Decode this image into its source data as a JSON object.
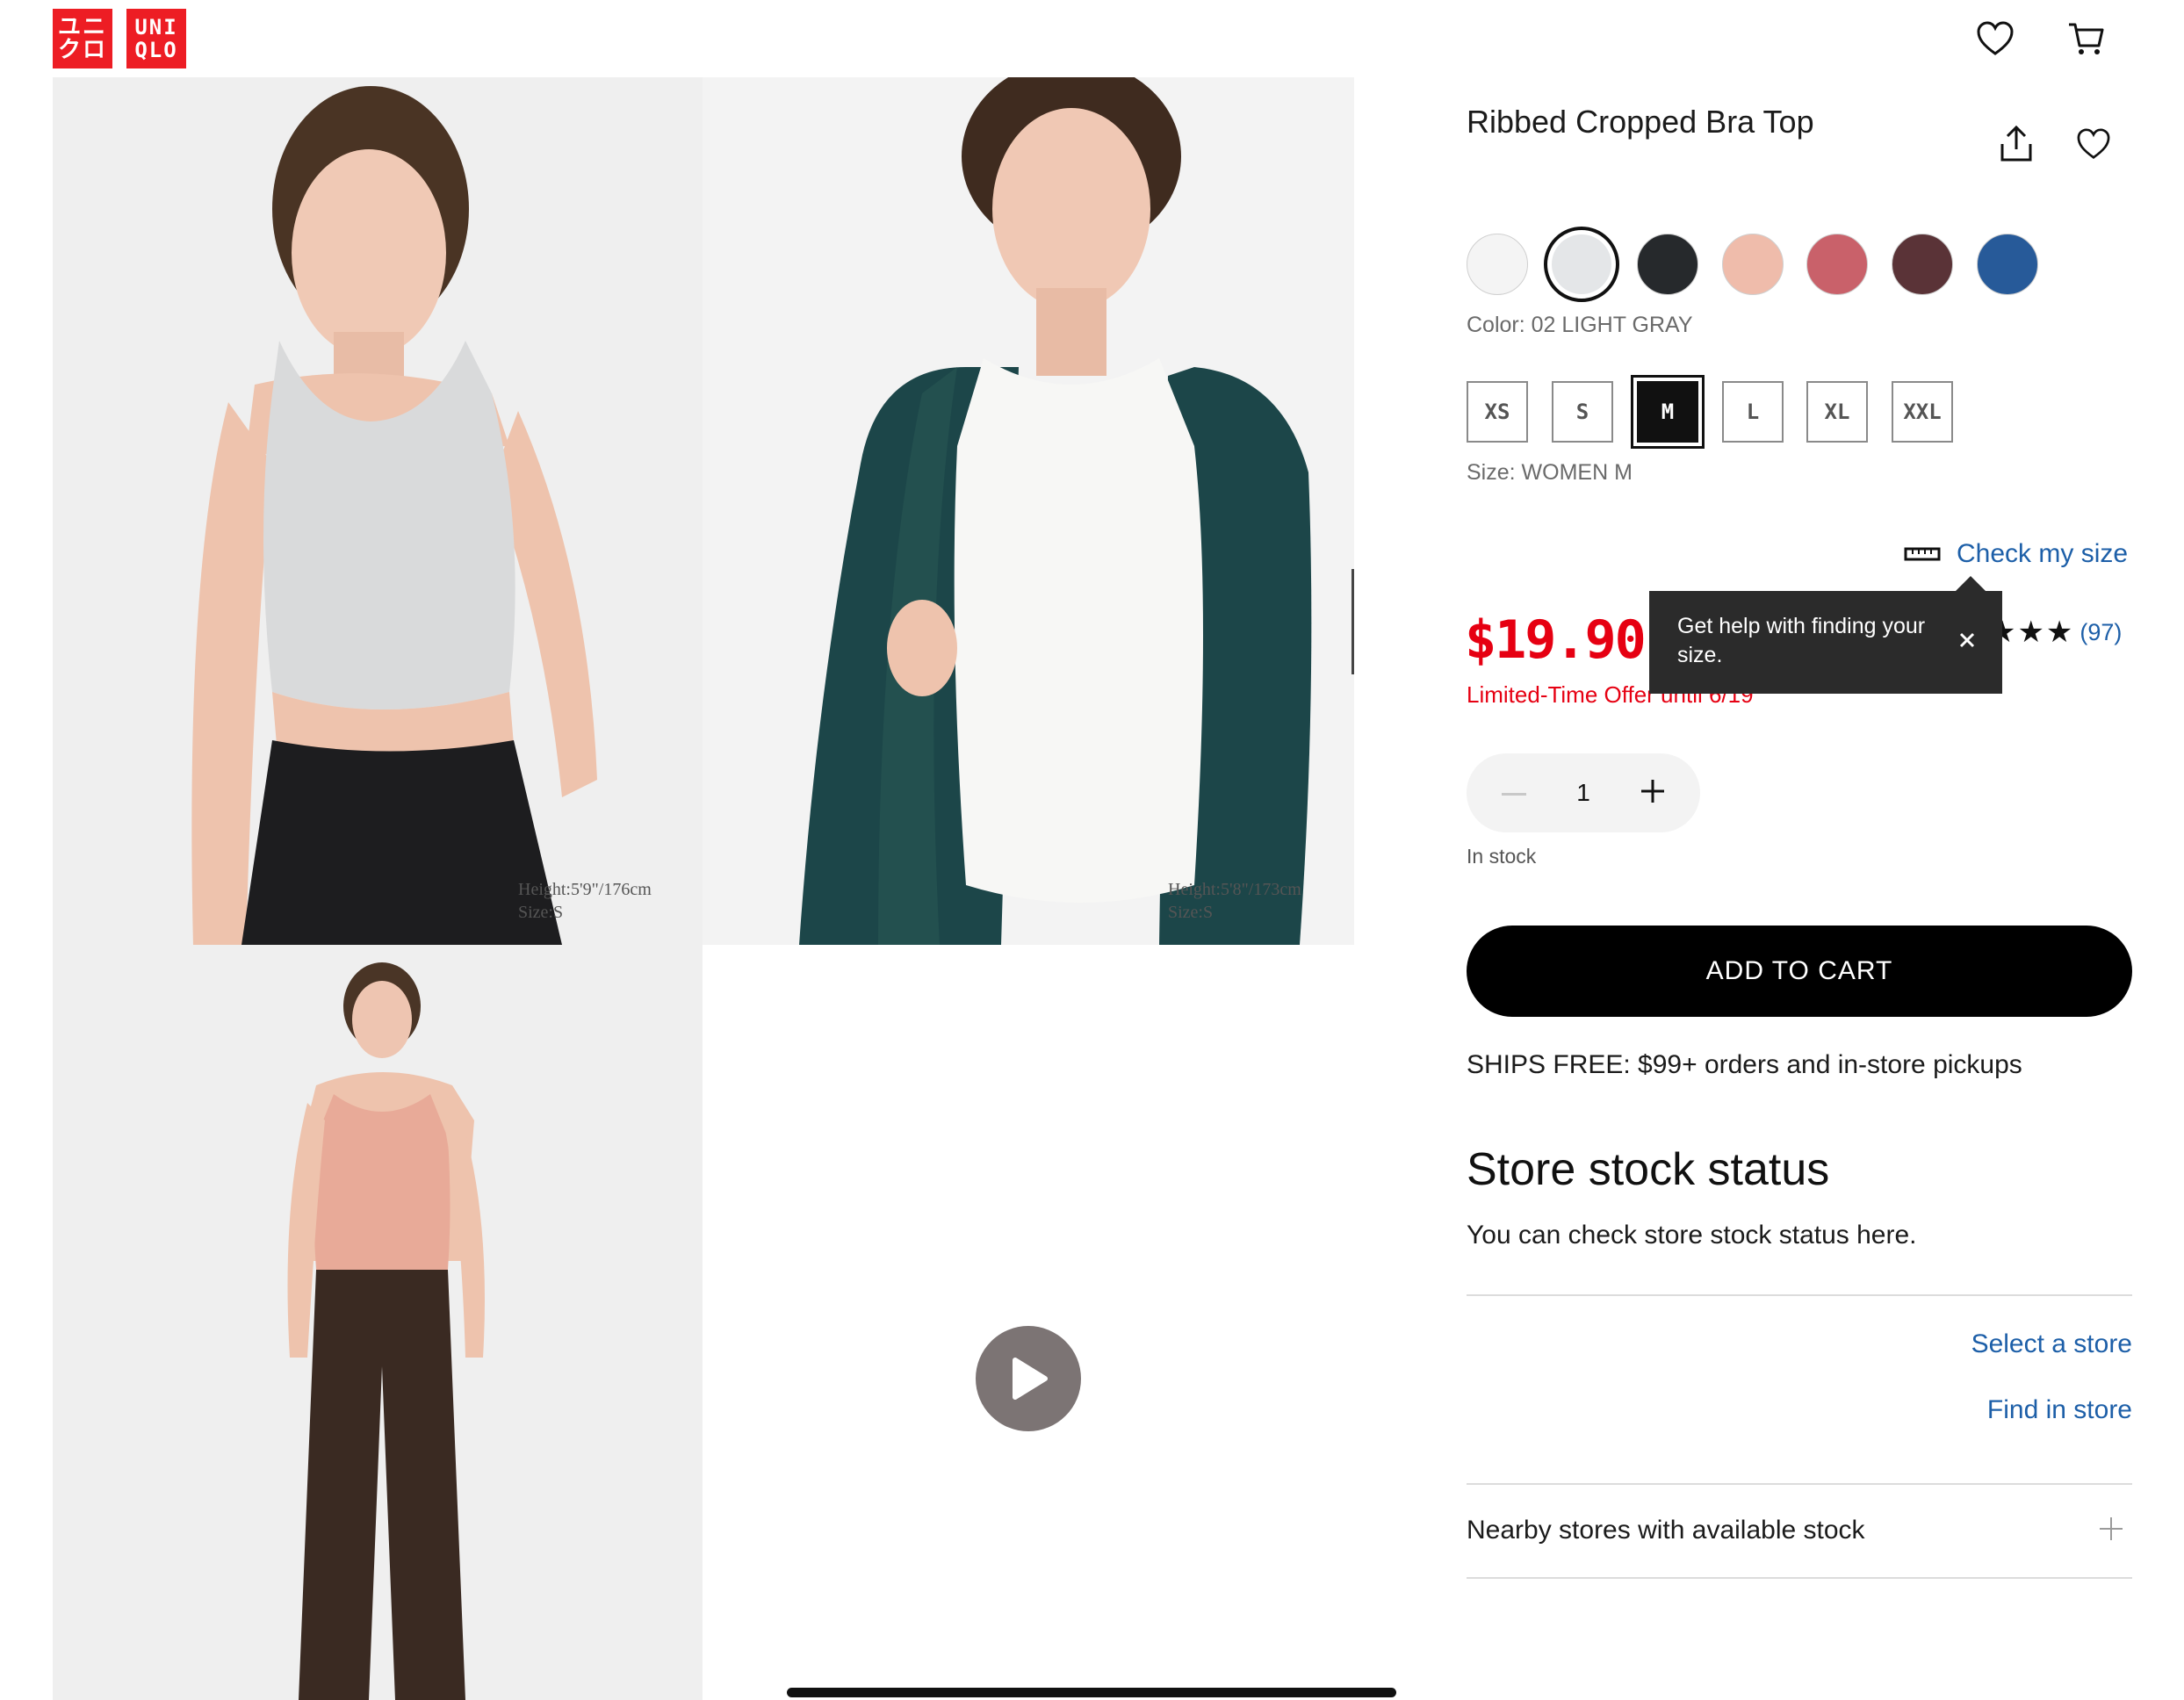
{
  "header": {
    "logo_top": "ユニ\nクロ",
    "logo_bottom": "UNI\nQLO",
    "wishlist_icon": "heart-icon",
    "cart_icon": "cart-icon"
  },
  "gallery": {
    "photo1_label": "Height:5'9\"/176cm\nSize:S",
    "photo2_label": "Height:5'8\"/173cm\nSize:S"
  },
  "product": {
    "title": "Ribbed Cropped Bra Top",
    "share_icon": "share-icon",
    "favorite_icon": "heart-icon",
    "colors": [
      {
        "name": "white",
        "hex": "#f4f4f4"
      },
      {
        "name": "light gray",
        "hex": "#e4e6e8",
        "selected": true
      },
      {
        "name": "black",
        "hex": "#26292c"
      },
      {
        "name": "pink",
        "hex": "#efbcab"
      },
      {
        "name": "rose",
        "hex": "#c9616a"
      },
      {
        "name": "brown",
        "hex": "#5a3337"
      },
      {
        "name": "blue",
        "hex": "#275a99"
      }
    ],
    "color_label": "Color: 02 LIGHT GRAY",
    "sizes": [
      "XS",
      "S",
      "M",
      "L",
      "XL",
      "XXL"
    ],
    "selected_size": "M",
    "size_label": "Size: WOMEN M",
    "check_size": "Check my size",
    "price": "$19.90",
    "offer": "Limited-Time Offer until 6/19",
    "tooltip": "Get help with finding your size.",
    "rating_stars": "★★★★★",
    "rating_count": "(97)",
    "quantity": "1",
    "stock": "In stock",
    "add_to_cart": "ADD TO CART",
    "shipping": "SHIPS FREE: $99+ orders and in-store pickups"
  },
  "store": {
    "heading": "Store stock status",
    "description": "You can check store stock status here.",
    "select_store": "Select a store",
    "find_in_store": "Find in store",
    "nearby": "Nearby stores with available stock"
  },
  "colors": {
    "accent_red": "#e60012",
    "link_blue": "#1d5fa8",
    "logo_red": "#ed1d24"
  }
}
